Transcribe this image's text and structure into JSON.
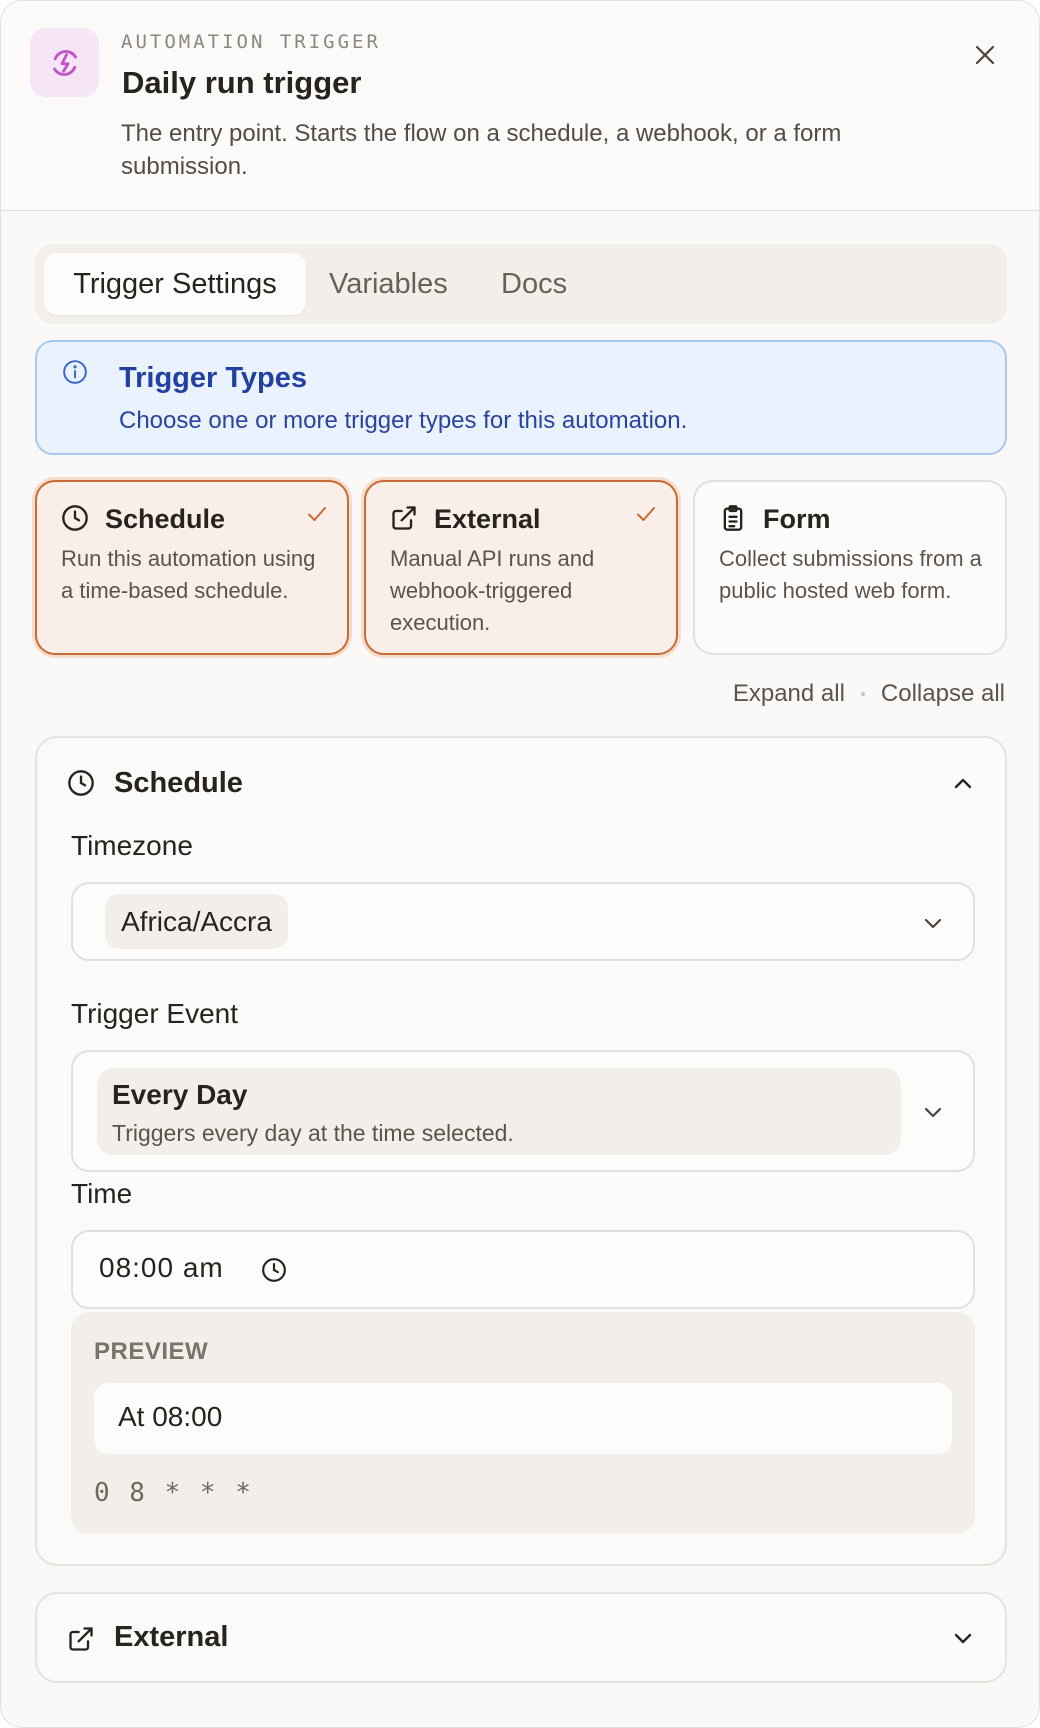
{
  "header": {
    "eyebrow": "AUTOMATION TRIGGER",
    "title": "Daily run trigger",
    "subtitle": "The entry point. Starts the flow on a schedule, a webhook, or a form submission.",
    "icon": "lightning-refresh-icon"
  },
  "tabs": [
    {
      "label": "Trigger Settings",
      "active": true
    },
    {
      "label": "Variables",
      "active": false
    },
    {
      "label": "Docs",
      "active": false
    }
  ],
  "info": {
    "title": "Trigger Types",
    "text": "Choose one or more trigger types for this automation."
  },
  "trigger_types": [
    {
      "title": "Schedule",
      "desc": "Run this automation using a time-based schedule.",
      "selected": true,
      "icon": "clock-icon"
    },
    {
      "title": "External",
      "desc": "Manual API runs and webhook-triggered execution.",
      "selected": true,
      "icon": "external-link-icon"
    },
    {
      "title": "Form",
      "desc": "Collect submissions from a public hosted web form.",
      "selected": false,
      "icon": "clipboard-icon"
    }
  ],
  "controls": {
    "expand_all": "Expand all",
    "collapse_all": "Collapse all"
  },
  "schedule": {
    "title": "Schedule",
    "timezone_label": "Timezone",
    "timezone_value": "Africa/Accra",
    "event_label": "Trigger Event",
    "event_title": "Every Day",
    "event_desc": "Triggers every day at the time selected.",
    "time_label": "Time",
    "time_value": "08:00 am",
    "preview_label": "PREVIEW",
    "preview_text": "At 08:00",
    "cron": "0 8 * * *"
  },
  "external": {
    "title": "External"
  },
  "colors": {
    "accent": "#c76c35",
    "info_bg": "#eaf3fd",
    "info_text": "#2340a0",
    "icon_tile": "#f6e4f7",
    "icon_stroke": "#c254c8"
  }
}
